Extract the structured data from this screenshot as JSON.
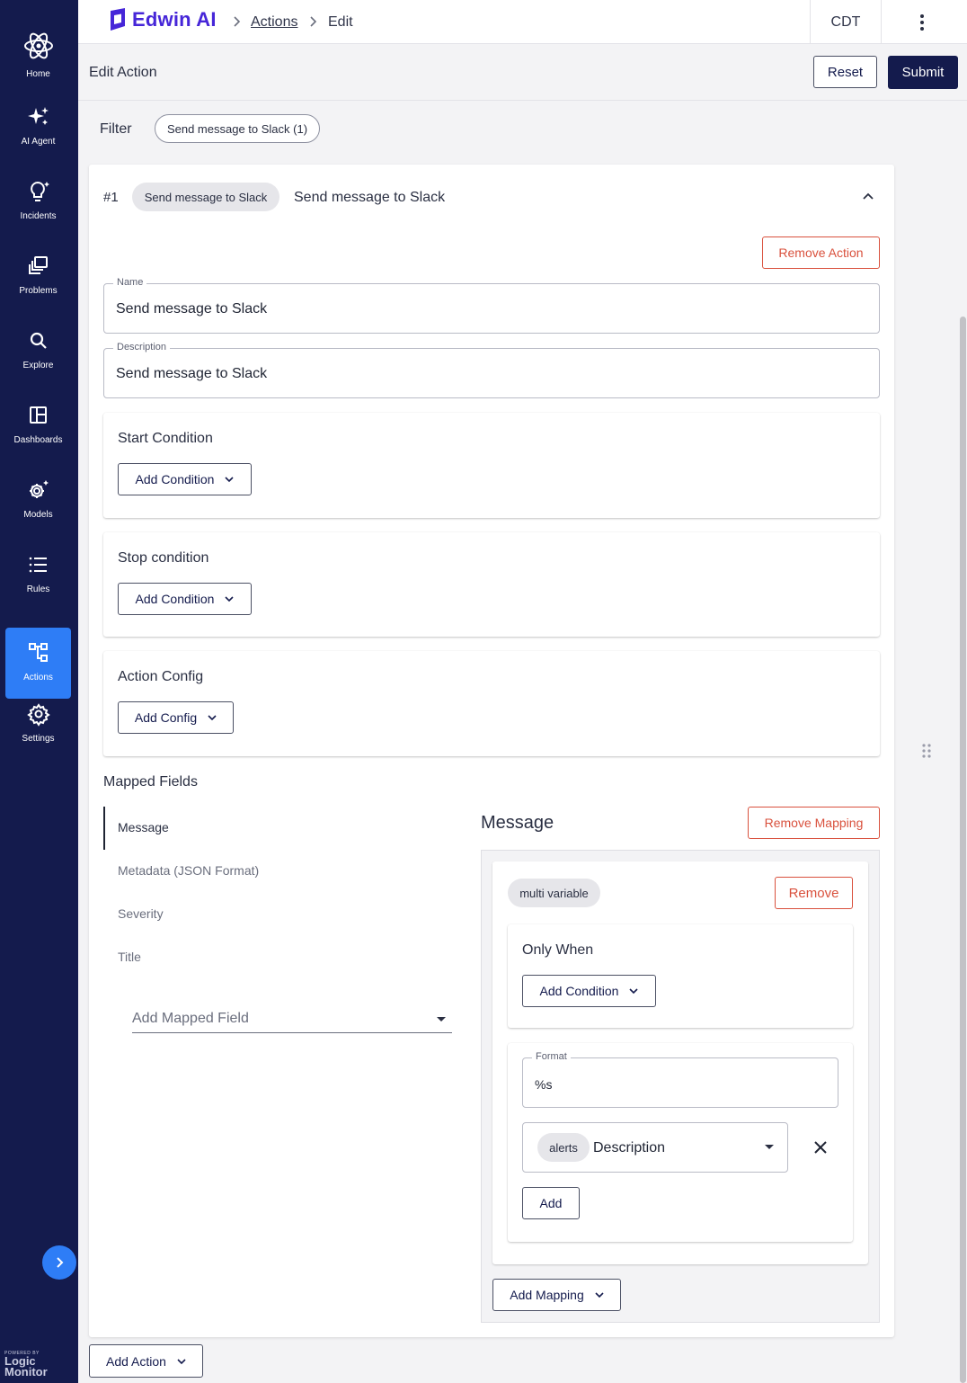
{
  "app": {
    "brand": "Edwin AI",
    "timezone": "CDT"
  },
  "breadcrumb": {
    "parent": "Actions",
    "current": "Edit"
  },
  "sidebar": {
    "items": [
      {
        "label": "Home",
        "icon": "atom-icon"
      },
      {
        "label": "AI Agent",
        "icon": "sparkles-icon"
      },
      {
        "label": "Incidents",
        "icon": "lightbulb-icon"
      },
      {
        "label": "Problems",
        "icon": "stack-icon"
      },
      {
        "label": "Explore",
        "icon": "search-icon"
      },
      {
        "label": "Dashboards",
        "icon": "dashboard-icon"
      },
      {
        "label": "Models",
        "icon": "gear-sparkle-icon"
      },
      {
        "label": "Rules",
        "icon": "list-icon"
      },
      {
        "label": "Actions",
        "icon": "workflow-icon",
        "active": true
      },
      {
        "label": "Settings",
        "icon": "gear-icon"
      }
    ],
    "footer_small": "POWERED BY",
    "footer_line1": "Logic",
    "footer_line2": "Monitor"
  },
  "page": {
    "title": "Edit Action",
    "reset_label": "Reset",
    "submit_label": "Submit",
    "filter_label": "Filter",
    "filter_chip": "Send message to Slack (1)"
  },
  "action": {
    "index": "#1",
    "type_chip": "Send message to Slack",
    "heading": "Send message to Slack",
    "remove_label": "Remove Action",
    "name_label": "Name",
    "name_value": "Send message to Slack",
    "description_label": "Description",
    "description_value": "Send message to Slack",
    "start_condition": {
      "title": "Start Condition",
      "button": "Add Condition"
    },
    "stop_condition": {
      "title": "Stop condition",
      "button": "Add Condition"
    },
    "action_config": {
      "title": "Action Config",
      "button": "Add Config"
    }
  },
  "mapped_fields": {
    "title": "Mapped Fields",
    "items": [
      "Message",
      "Metadata (JSON Format)",
      "Severity",
      "Title"
    ],
    "active": "Message",
    "add_placeholder": "Add Mapped Field"
  },
  "mapping": {
    "title": "Message",
    "remove_mapping_label": "Remove Mapping",
    "variable_chip": "multi variable",
    "remove_label": "Remove",
    "only_when": {
      "title": "Only When",
      "button": "Add Condition"
    },
    "format_label": "Format",
    "format_value": "%s",
    "variable_source_chip": "alerts",
    "variable_value": "Description",
    "add_label": "Add",
    "add_mapping_label": "Add Mapping"
  },
  "footer": {
    "add_action_label": "Add Action"
  },
  "colors": {
    "sidebar": "#141b4d",
    "accent": "#2e7df6",
    "brand": "#4626d8",
    "danger": "#d9513d"
  }
}
